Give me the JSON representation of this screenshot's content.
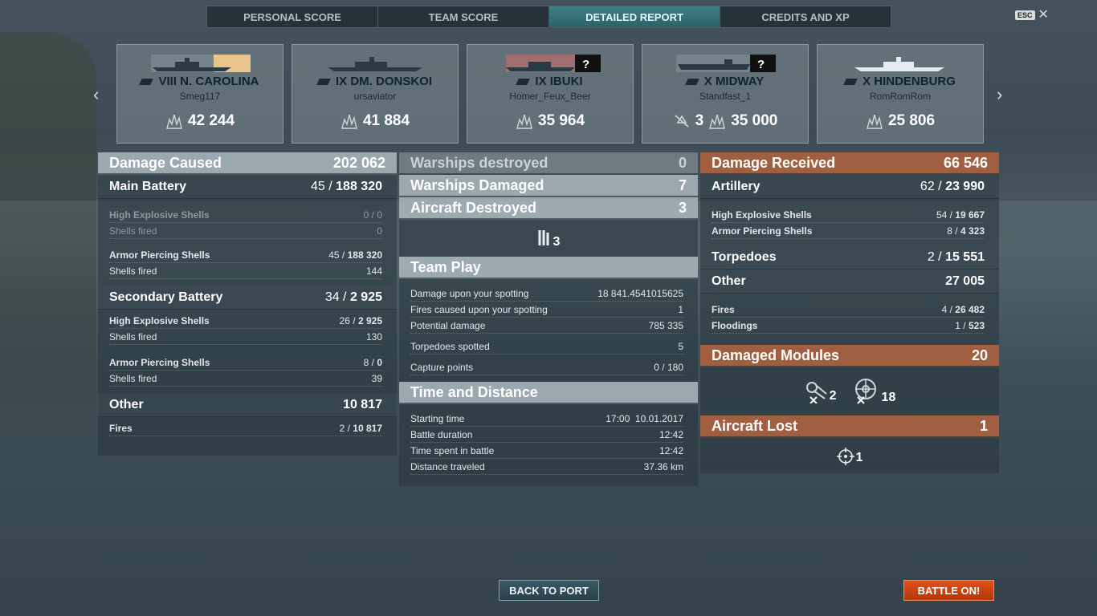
{
  "tabs": [
    {
      "label": "PERSONAL SCORE"
    },
    {
      "label": "TEAM SCORE"
    },
    {
      "label": "DETAILED REPORT"
    },
    {
      "label": "CREDITS AND XP"
    }
  ],
  "esc": {
    "key": "ESC",
    "close": "✕"
  },
  "nav": {
    "prev": "‹",
    "next": "›"
  },
  "ships": [
    {
      "name": "VIII N. CAROLINA",
      "player": "Smeg117",
      "score": "42 244",
      "kills": ""
    },
    {
      "name": "IX DM. DONSKOI",
      "player": "ursaviator",
      "score": "41 884",
      "kills": ""
    },
    {
      "name": "IX IBUKI",
      "player": "Homer_Feux_Beer",
      "score": "35 964",
      "kills": ""
    },
    {
      "name": "X MIDWAY",
      "player": "Standfast_1",
      "score": "35 000",
      "kills": "3"
    },
    {
      "name": "X HINDENBURG",
      "player": "RomRomRom",
      "score": "25 806",
      "kills": ""
    }
  ],
  "left": {
    "damage_caused": {
      "label": "Damage Caused",
      "value": "202 062"
    },
    "main_battery": {
      "label": "Main Battery",
      "hits": "45 / ",
      "dmg": "188 320"
    },
    "mb_he": {
      "label": "High Explosive Shells",
      "value": "0 / 0"
    },
    "mb_he_fired": {
      "label": "Shells fired",
      "value": "0"
    },
    "mb_ap": {
      "label": "Armor Piercing Shells",
      "hits": "45 / ",
      "dmg": "188 320"
    },
    "mb_ap_fired": {
      "label": "Shells fired",
      "value": "144"
    },
    "secondary": {
      "label": "Secondary Battery",
      "hits": "34 / ",
      "dmg": "2 925"
    },
    "sb_he": {
      "label": "High Explosive Shells",
      "hits": "26 / ",
      "dmg": "2 925"
    },
    "sb_he_fired": {
      "label": "Shells fired",
      "value": "130"
    },
    "sb_ap": {
      "label": "Armor Piercing Shells",
      "hits": "8 / ",
      "dmg": "0"
    },
    "sb_ap_fired": {
      "label": "Shells fired",
      "value": "39"
    },
    "other": {
      "label": "Other",
      "value": "10 817"
    },
    "fires": {
      "label": "Fires",
      "hits": "2 / ",
      "dmg": "10 817"
    }
  },
  "middle": {
    "destroyed": {
      "label": "Warships destroyed",
      "value": "0"
    },
    "damaged": {
      "label": "Warships Damaged",
      "value": "7"
    },
    "aircraft": {
      "label": "Aircraft Destroyed",
      "value": "3"
    },
    "aircraft_icon_count": "3",
    "team_play": {
      "label": "Team Play"
    },
    "spotting_dmg": {
      "label": "Damage upon your spotting",
      "value": "18 841.4541015625"
    },
    "spotting_fires": {
      "label": "Fires caused upon your spotting",
      "value": "1"
    },
    "potential": {
      "label": "Potential damage",
      "value": "785 335"
    },
    "torp_spotted": {
      "label": "Torpedoes spotted",
      "value": "5"
    },
    "capture": {
      "label": "Capture points",
      "value": "0 / 180"
    },
    "time_distance": {
      "label": "Time and Distance"
    },
    "start": {
      "label": "Starting time",
      "value": "17:00  10.01.2017"
    },
    "duration": {
      "label": "Battle duration",
      "value": "12:42"
    },
    "spent": {
      "label": "Time spent in battle",
      "value": "12:42"
    },
    "distance": {
      "label": "Distance traveled",
      "value": "37.36 km"
    }
  },
  "right": {
    "received": {
      "label": "Damage Received",
      "value": "66 546"
    },
    "artillery": {
      "label": "Artillery",
      "hits": "62 / ",
      "dmg": "23 990"
    },
    "he": {
      "label": "High Explosive Shells",
      "hits": "54 / ",
      "dmg": "19 667"
    },
    "ap": {
      "label": "Armor Piercing Shells",
      "hits": "8 / ",
      "dmg": "4 323"
    },
    "torpedoes": {
      "label": "Torpedoes",
      "hits": "2 / ",
      "dmg": "15 551"
    },
    "other": {
      "label": "Other",
      "value": "27 005"
    },
    "fires": {
      "label": "Fires",
      "hits": "4 / ",
      "dmg": "26 482"
    },
    "floodings": {
      "label": "Floodings",
      "hits": "1 / ",
      "dmg": "523"
    },
    "modules": {
      "label": "Damaged Modules",
      "value": "20"
    },
    "module_guns": "2",
    "module_steering": "18",
    "aircraft_lost": {
      "label": "Aircraft Lost",
      "value": "1"
    },
    "aircraft_lost_count": "1"
  },
  "buttons": {
    "back": "BACK TO PORT",
    "battle": "BATTLE ON!"
  }
}
